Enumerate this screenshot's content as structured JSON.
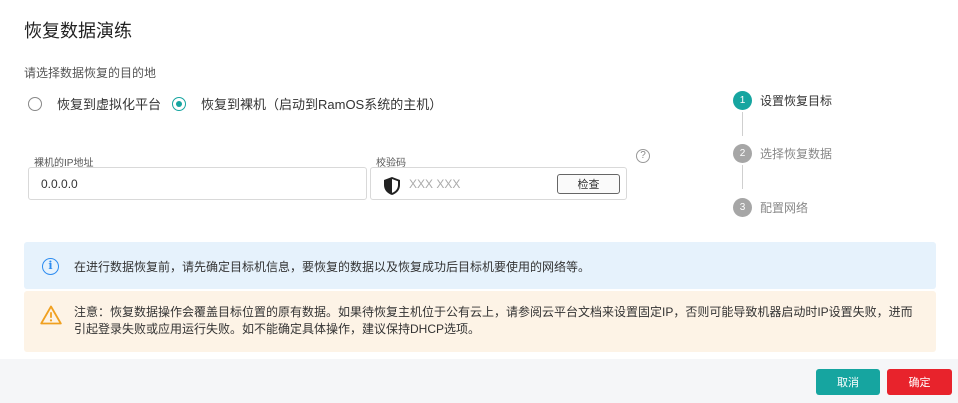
{
  "dialog": {
    "title": "恢复数据演练"
  },
  "destination": {
    "label": "请选择数据恢复的目的地",
    "options": [
      {
        "label": "恢复到虚拟化平台",
        "selected": false
      },
      {
        "label": "恢复到裸机（启动到RamOS系统的主机）",
        "selected": true
      }
    ]
  },
  "ip_field": {
    "label": "裸机的IP地址",
    "value": "0.0.0.0"
  },
  "code_field": {
    "label": "校验码",
    "placeholder": "XXX XXX",
    "check_button": "检查",
    "icon": "shield-icon"
  },
  "help": {
    "glyph": "?"
  },
  "steps": [
    {
      "number": "1",
      "label": "设置恢复目标",
      "active": true
    },
    {
      "number": "2",
      "label": "选择恢复数据",
      "active": false
    },
    {
      "number": "3",
      "label": "配置网络",
      "active": false
    }
  ],
  "info_banner": {
    "icon_glyph": "i",
    "text": "在进行数据恢复前，请先确定目标机信息，要恢复的数据以及恢复成功后目标机要使用的网络等。"
  },
  "warning_banner": {
    "text": "注意：恢复数据操作会覆盖目标位置的原有数据。如果待恢复主机位于公有云上，请参阅云平台文档来设置固定IP，否则可能导致机器启动时IP设置失败，进而引起登录失败或应用运行失败。如不能确定具体操作，建议保持DHCP选项。"
  },
  "footer": {
    "cancel_label": "取消",
    "confirm_label": "确定"
  },
  "colors": {
    "accent": "#16a5a0",
    "danger": "#e8232c",
    "step_inactive": "#a6a6a6",
    "info_bg": "#e6f2fc",
    "warning_bg": "#fdf3e6",
    "warning_icon": "#f0a020"
  }
}
